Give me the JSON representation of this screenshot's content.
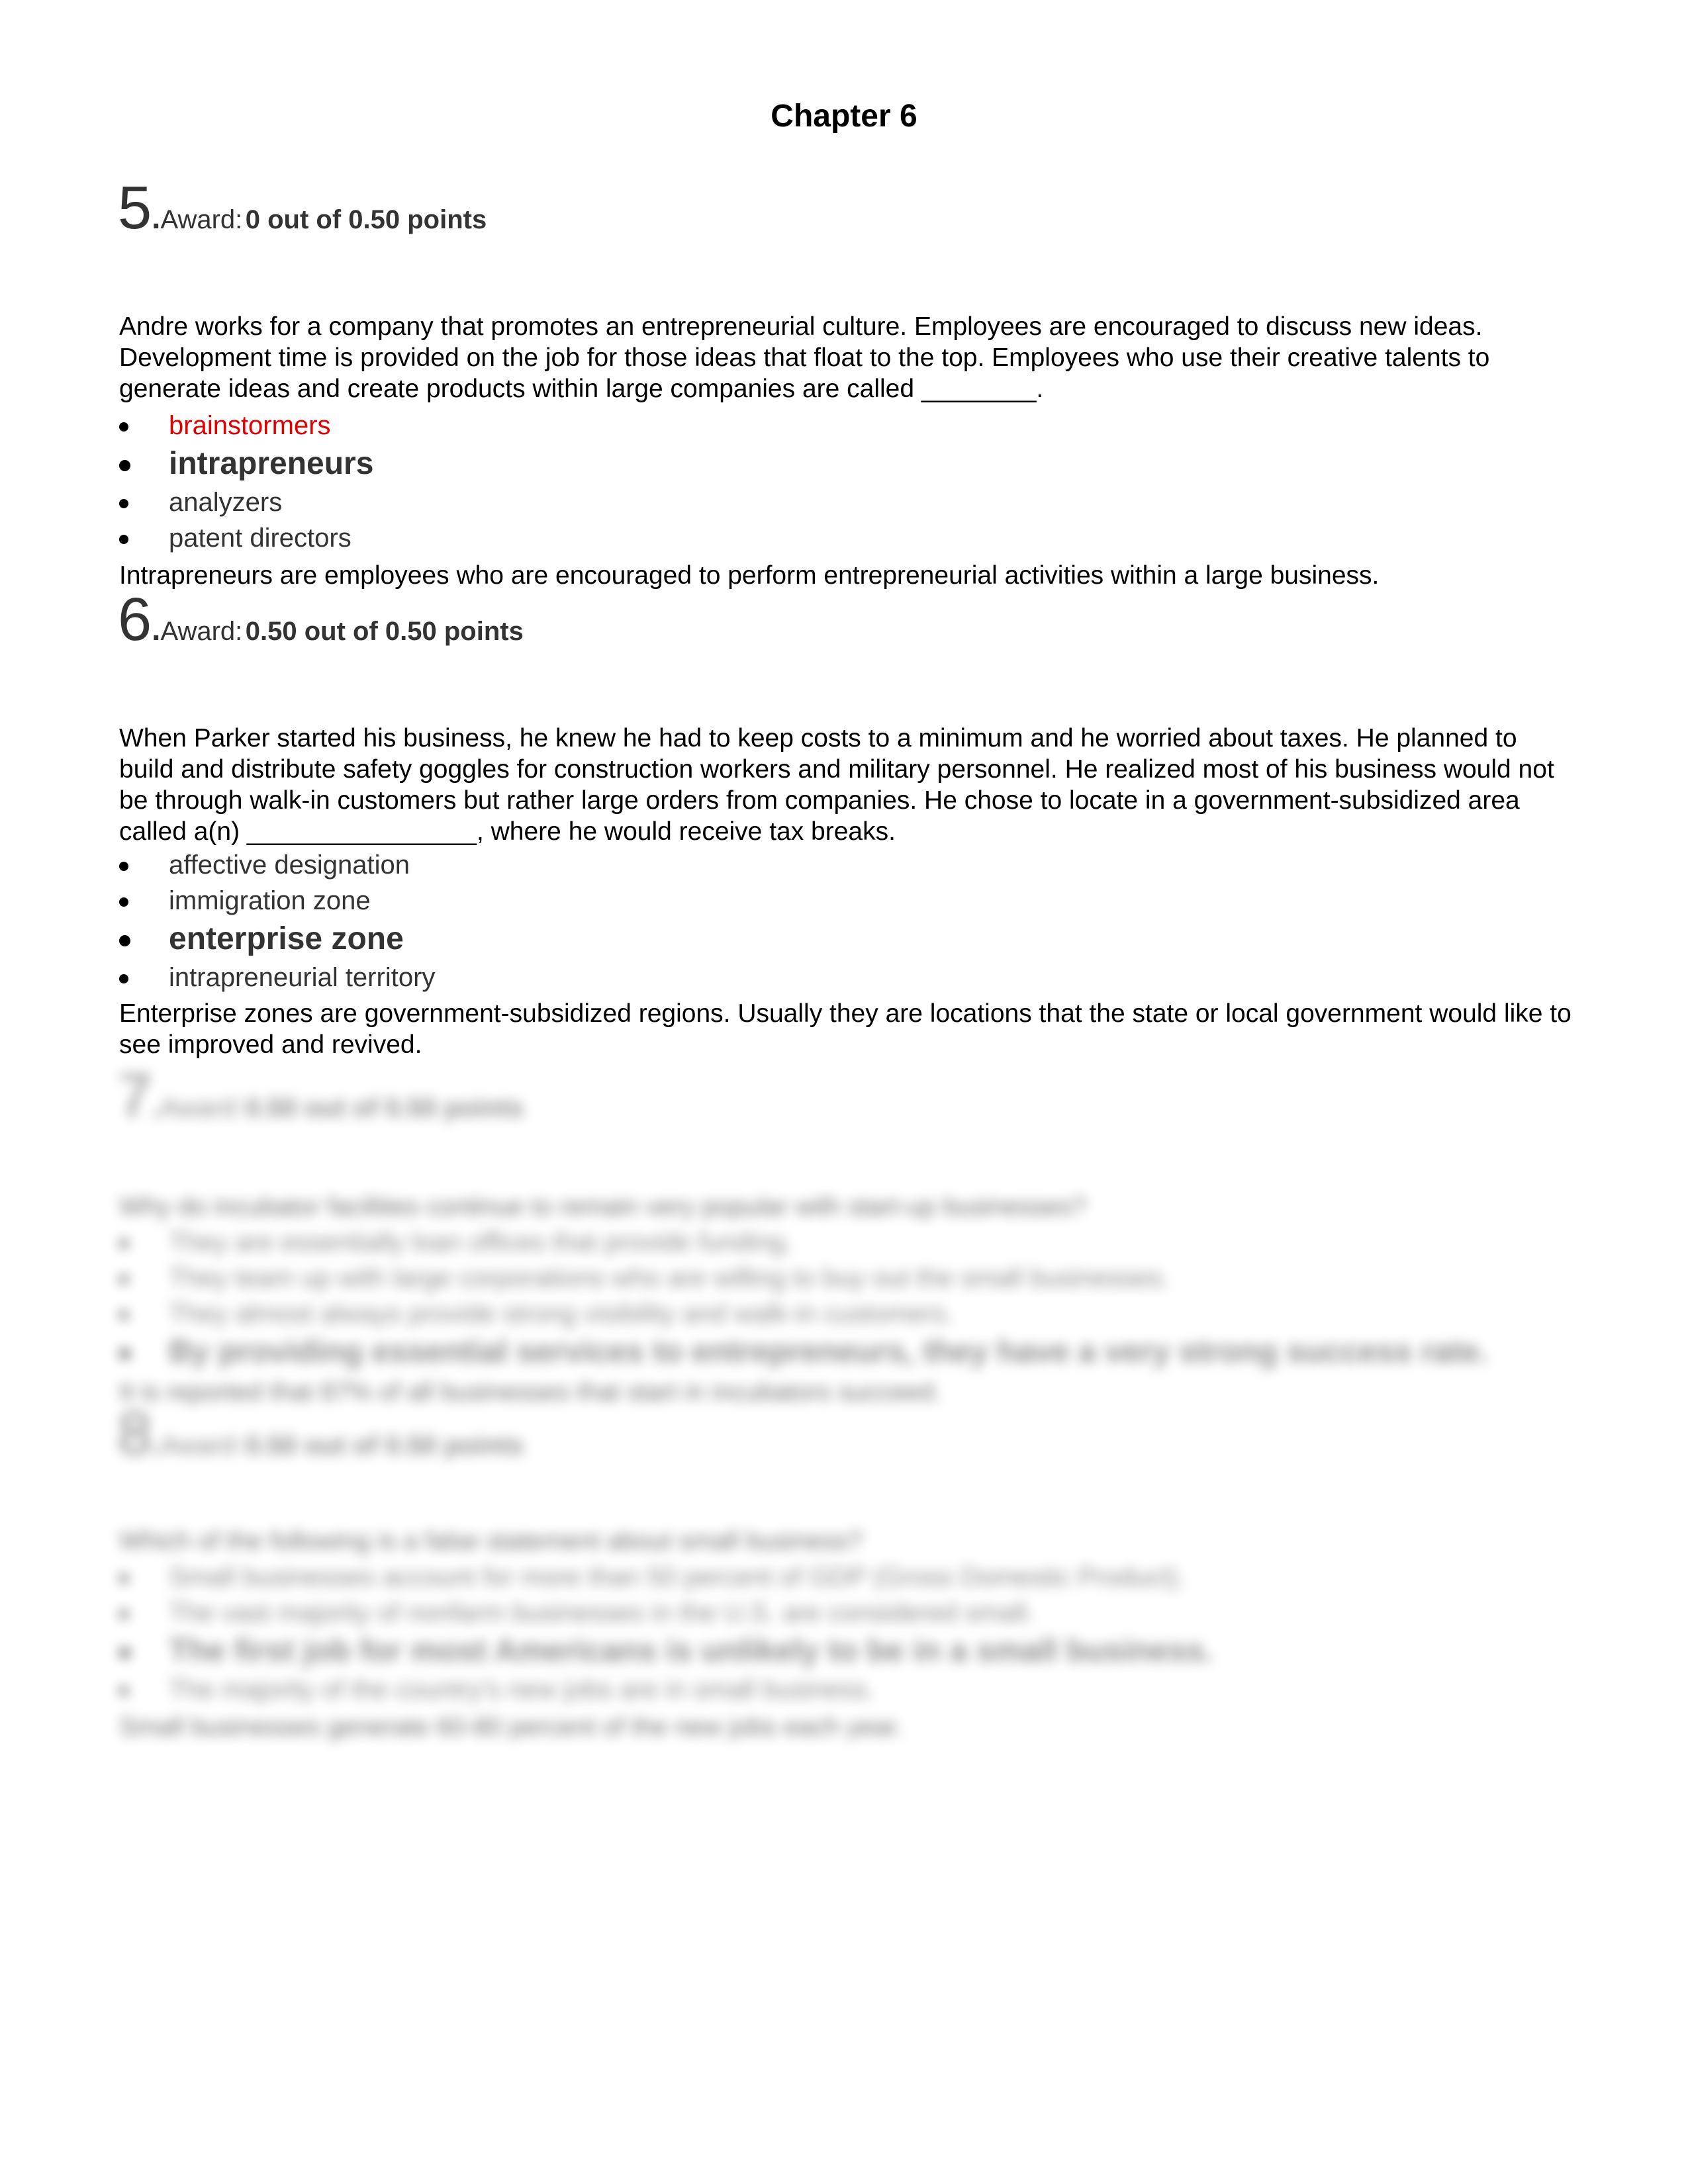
{
  "document": {
    "title": "Chapter 6"
  },
  "questions": [
    {
      "number": "5",
      "award_label": "Award:",
      "award_value": "0 out of 0.50 points",
      "text": "Andre works for a company that promotes an entrepreneurial culture. Employees are encouraged to discuss new ideas. Development time is provided on the job for those ideas that float to the top. Employees who use their creative talents to generate ideas and create products within large companies are called ________.",
      "options": [
        {
          "label": "brainstormers",
          "state": "selected-wrong"
        },
        {
          "label": "intrapreneurs",
          "state": "correct"
        },
        {
          "label": "analyzers",
          "state": "normal"
        },
        {
          "label": "patent directors",
          "state": "normal"
        }
      ],
      "explanation": "Intrapreneurs are employees who are encouraged to perform entrepreneurial activities within a large business."
    },
    {
      "number": "6",
      "award_label": "Award:",
      "award_value": "0.50 out of 0.50 points",
      "text": "When Parker started his business, he knew he had to keep costs to a minimum and he worried about taxes. He planned to build and distribute safety goggles for construction workers and military personnel. He realized most of his business would not be through walk-in customers but rather large orders from companies. He chose to locate in a government-subsidized area called a(n) ________________, where he would receive tax breaks.",
      "options": [
        {
          "label": "affective designation",
          "state": "normal"
        },
        {
          "label": "immigration zone",
          "state": "normal"
        },
        {
          "label": "enterprise zone",
          "state": "correct"
        },
        {
          "label": "intrapreneurial territory",
          "state": "normal"
        }
      ],
      "explanation": "Enterprise zones are government-subsidized regions. Usually they are locations that the state or local government would like to see improved and revived."
    },
    {
      "number": "7",
      "award_label": "Award:",
      "award_value": "0.50 out of 0.50 points",
      "text": "Why do incubator facilities continue to remain very popular with start-up businesses?",
      "options": [
        {
          "label": "They are essentially loan offices that provide funding.",
          "state": "normal"
        },
        {
          "label": "They team up with large corporations who are willing to buy out the small businesses.",
          "state": "normal"
        },
        {
          "label": "They almost always provide strong visibility and walk-in customers.",
          "state": "normal"
        },
        {
          "label": "By providing essential services to entrepreneurs, they have a very strong success rate.",
          "state": "correct"
        }
      ],
      "explanation": "It is reported that 87% of all businesses that start in incubators succeed."
    },
    {
      "number": "8",
      "award_label": "Award:",
      "award_value": "0.50 out of 0.50 points",
      "text": "Which of the following is a false statement about small business?",
      "options": [
        {
          "label": "Small businesses account for more than 50 percent of GDP (Gross Domestic Product).",
          "state": "normal"
        },
        {
          "label": "The vast majority of nonfarm businesses in the U.S. are considered small.",
          "state": "normal"
        },
        {
          "label": "The first job for most Americans is unlikely to be in a small business.",
          "state": "correct"
        },
        {
          "label": "The majority of the country's new jobs are in small business.",
          "state": "normal"
        }
      ],
      "explanation": "Small businesses generate 60-80 percent of the new jobs each year."
    }
  ],
  "colors": {
    "wrong_answer": "#e00000",
    "header_text": "#333333",
    "body_text": "#000000"
  }
}
